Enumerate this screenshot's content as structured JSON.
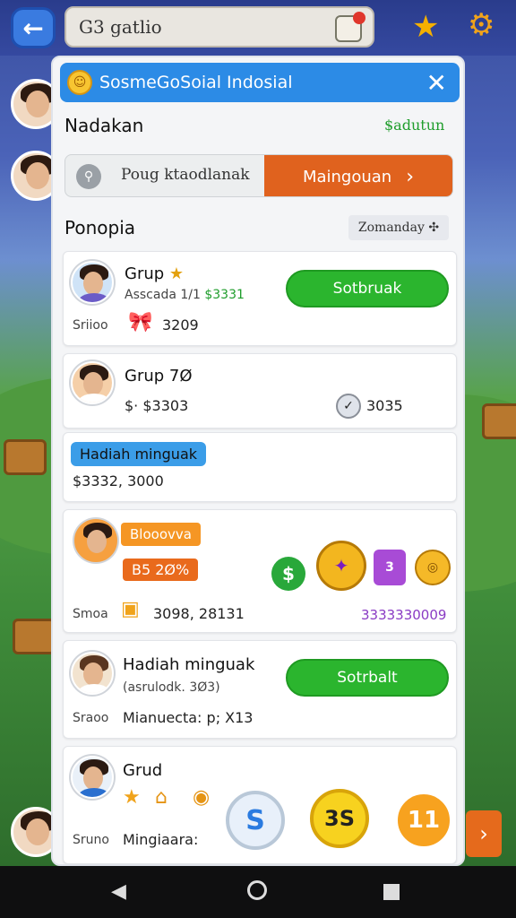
{
  "topbar": {
    "search_text": "G3 gatlio",
    "back_label": "←"
  },
  "modal": {
    "title": "SosmeGoSoial Indosial",
    "close_label": "✕",
    "section1_title": "Nadakan",
    "section1_link": "$adutun",
    "search_placeholder": "Poug ktaodlanak",
    "search_button": "Maingouan",
    "search_button_chevron": "›",
    "section2_title": "Ponopia",
    "sort_label": "Zomanday ✣"
  },
  "cards": [
    {
      "name": "Grup",
      "name_suffix": "★",
      "sub": "Asscada 1/1",
      "sub_value": "$3331",
      "left_label": "Sriioo",
      "value": "3209",
      "button": "Sotbruak"
    },
    {
      "name": "Grup 7Ø",
      "value_left": "$· $3303",
      "value_right": "3035"
    },
    {
      "pill": "Hadiah minguak",
      "value": "$3332, 3000"
    },
    {
      "tag": "Blooovva",
      "tag2": "B5 2Ø%",
      "left_label": "Smoa",
      "value": "3098, 28131",
      "purple": "3333330009"
    },
    {
      "name": "Hadiah minguak",
      "sub": "(asrulodk. 3Ø3)",
      "left_label": "Sraoo",
      "value": "Mianuecta: p; X13",
      "button": "Sotrbalt"
    },
    {
      "name": "Grud",
      "left_label": "Sruno",
      "value": "Mingiaara:"
    }
  ],
  "rewards": {
    "coin1": "S",
    "coin2": "3S",
    "coin3": "11",
    "dollar": "$"
  },
  "icons": {
    "back": "arrow-left-icon",
    "star": "star-icon",
    "gear": "gear-icon",
    "search": "search-icon",
    "close": "close-icon"
  },
  "colors": {
    "header_blue": "#2c8be6",
    "button_green": "#2bb52e",
    "button_orange": "#e0621e"
  }
}
